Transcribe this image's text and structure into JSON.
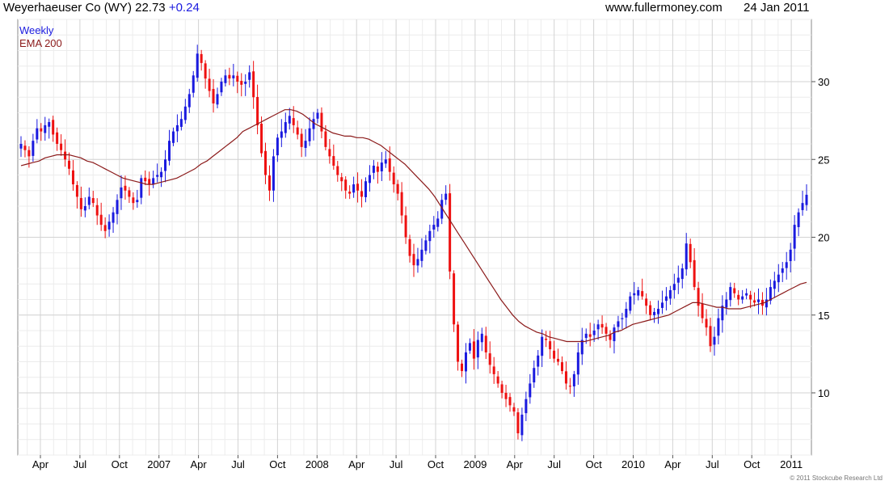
{
  "header": {
    "name": "Weyerhaeuser Co (WY)",
    "price": "22.73",
    "change": "+0.24",
    "site": "www.fullermoney.com",
    "date": "24 Jan 2011"
  },
  "legend": {
    "series1": "Weekly",
    "series2": "EMA 200"
  },
  "copyright": "© 2011 Stockcube Research Ltd",
  "colors": {
    "up": "#1a1adf",
    "down": "#ee1111",
    "ema": "#8b1a1a",
    "grid": "#d3d3d3"
  },
  "chart_data": {
    "type": "candlestick",
    "title": "Weyerhaeuser Co (WY)",
    "frequency": "Weekly",
    "y_axis": {
      "side": "right",
      "range": [
        6,
        34
      ],
      "ticks": [
        10,
        15,
        20,
        25,
        30
      ]
    },
    "x_tick_labels": [
      "Apr",
      "Jul",
      "Oct",
      "2007",
      "Apr",
      "Jul",
      "Oct",
      "2008",
      "Apr",
      "Jul",
      "Oct",
      "2009",
      "Apr",
      "Jul",
      "Oct",
      "2010",
      "Apr",
      "Jul",
      "Oct",
      "2011"
    ],
    "grid": true,
    "weekly_close": [
      26.0,
      25.6,
      25.2,
      26.2,
      27.0,
      26.8,
      27.2,
      27.4,
      26.6,
      26.0,
      25.6,
      25.0,
      24.4,
      23.4,
      22.6,
      21.8,
      22.0,
      22.6,
      22.2,
      21.4,
      20.8,
      20.4,
      21.0,
      21.6,
      22.4,
      23.2,
      23.0,
      22.6,
      22.2,
      22.4,
      23.8,
      23.6,
      23.4,
      23.8,
      24.0,
      24.2,
      25.0,
      26.2,
      26.8,
      27.2,
      27.6,
      28.4,
      29.2,
      30.4,
      31.8,
      31.2,
      30.2,
      29.4,
      28.6,
      29.2,
      30.0,
      30.4,
      30.2,
      30.4,
      30.0,
      29.8,
      30.0,
      30.6,
      29.0,
      27.2,
      25.4,
      24.0,
      23.0,
      25.2,
      26.4,
      26.8,
      27.4,
      27.8,
      27.2,
      26.6,
      25.8,
      26.2,
      27.0,
      27.6,
      28.0,
      26.8,
      25.8,
      25.2,
      24.6,
      24.0,
      23.6,
      23.0,
      22.8,
      23.4,
      23.0,
      22.6,
      23.6,
      24.0,
      24.6,
      24.2,
      24.8,
      25.0,
      24.2,
      23.4,
      22.8,
      21.4,
      20.0,
      18.8,
      18.2,
      18.6,
      19.2,
      19.8,
      20.4,
      20.8,
      21.2,
      22.4,
      22.8,
      17.8,
      14.4,
      12.0,
      11.4,
      12.6,
      13.2,
      12.2,
      13.4,
      13.8,
      12.6,
      11.8,
      11.2,
      10.6,
      10.0,
      9.6,
      9.2,
      8.8,
      7.4,
      8.6,
      9.6,
      10.6,
      11.6,
      12.4,
      13.6,
      13.4,
      12.8,
      12.2,
      12.0,
      11.4,
      10.6,
      10.4,
      11.2,
      12.6,
      13.4,
      13.8,
      13.6,
      14.0,
      14.4,
      14.2,
      13.8,
      13.4,
      14.2,
      14.6,
      14.8,
      15.4,
      16.2,
      16.4,
      16.6,
      16.2,
      15.6,
      15.0,
      15.2,
      15.4,
      15.8,
      16.2,
      16.6,
      17.0,
      17.4,
      18.0,
      19.6,
      18.4,
      16.8,
      15.6,
      14.8,
      14.2,
      13.0,
      13.6,
      14.8,
      15.6,
      16.0,
      16.8,
      16.4,
      16.0,
      16.2,
      16.4,
      16.0,
      15.8,
      16.0,
      15.6,
      16.0,
      16.8,
      17.2,
      17.6,
      18.0,
      18.4,
      19.2,
      20.8,
      21.6,
      22.2,
      22.73
    ],
    "ema200": [
      24.6,
      24.7,
      24.8,
      24.9,
      25.1,
      25.2,
      25.3,
      25.3,
      25.3,
      25.2,
      25.1,
      24.9,
      24.8,
      24.6,
      24.4,
      24.2,
      24.0,
      23.8,
      23.7,
      23.6,
      23.5,
      23.4,
      23.4,
      23.5,
      23.6,
      23.7,
      23.8,
      24.0,
      24.2,
      24.4,
      24.7,
      24.9,
      25.2,
      25.5,
      25.8,
      26.1,
      26.4,
      26.8,
      27.0,
      27.2,
      27.4,
      27.6,
      27.8,
      28.0,
      28.2,
      28.2,
      28.1,
      27.9,
      27.6,
      27.3,
      27.1,
      26.9,
      26.7,
      26.6,
      26.5,
      26.5,
      26.4,
      26.4,
      26.3,
      26.1,
      25.9,
      25.6,
      25.3,
      25.0,
      24.7,
      24.3,
      23.9,
      23.5,
      23.1,
      22.6,
      22.0,
      21.4,
      20.8,
      20.2,
      19.6,
      19.0,
      18.4,
      17.8,
      17.2,
      16.6,
      16.0,
      15.5,
      15.0,
      14.6,
      14.3,
      14.1,
      13.9,
      13.8,
      13.6,
      13.5,
      13.4,
      13.3,
      13.3,
      13.3,
      13.3,
      13.4,
      13.5,
      13.6,
      13.7,
      13.9,
      14.0,
      14.2,
      14.4,
      14.5,
      14.6,
      14.7,
      14.8,
      14.9,
      15.0,
      15.2,
      15.4,
      15.6,
      15.8,
      15.8,
      15.7,
      15.6,
      15.5,
      15.5,
      15.4,
      15.4,
      15.4,
      15.5,
      15.6,
      15.7,
      15.8,
      16.0,
      16.2,
      16.4,
      16.6,
      16.8,
      17.0,
      17.1
    ]
  }
}
